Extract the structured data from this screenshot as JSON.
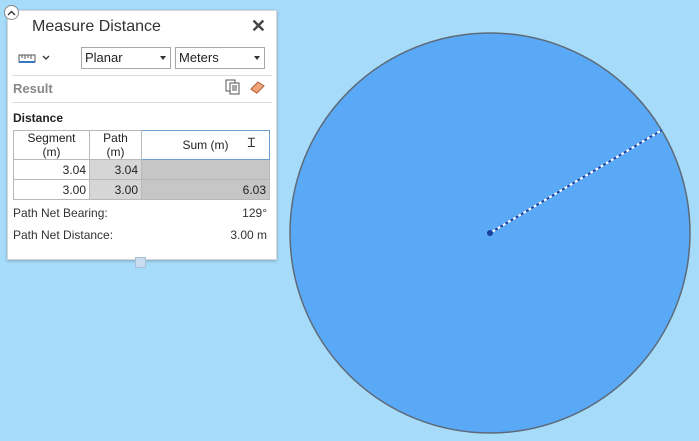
{
  "panel": {
    "title": "Measure Distance",
    "close_glyph": "✕",
    "mode": "Planar",
    "unit": "Meters",
    "result_label": "Result",
    "distance_label": "Distance",
    "table": {
      "headers": [
        "Segment (m)",
        "Path (m)",
        "Sum (m)"
      ],
      "rows": [
        {
          "segment": "3.04",
          "path": "3.04",
          "sum": ""
        },
        {
          "segment": "3.00",
          "path": "3.00",
          "sum": "6.03"
        }
      ]
    },
    "bearing_label": "Path Net Bearing:",
    "bearing_value": "129°",
    "net_distance_label": "Path Net Distance:",
    "net_distance_value": "3.00 m"
  },
  "icons": {
    "collapse": "chevron-up-icon",
    "unit_tool": "ruler-icon",
    "copy": "copy-icon",
    "clear": "eraser-icon"
  },
  "colors": {
    "map_background": "#a6dcfa",
    "circle_fill": "#5aa9f6",
    "circle_stroke": "#5e6a78",
    "measure_line": "#1a3fa0"
  }
}
